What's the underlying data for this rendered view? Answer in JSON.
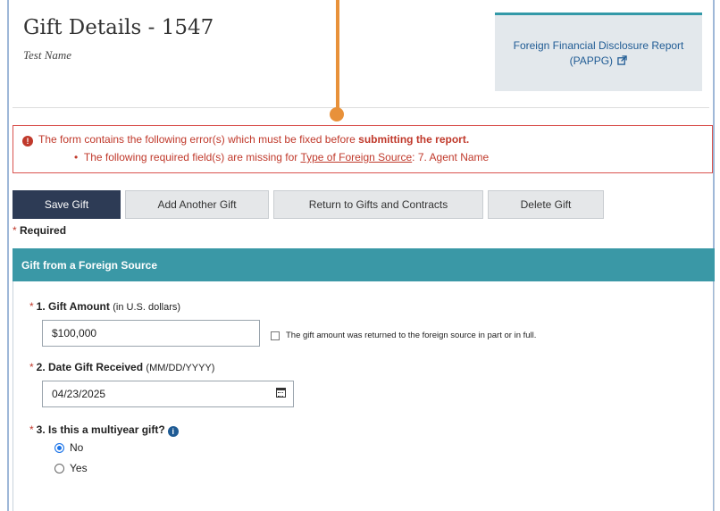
{
  "header": {
    "title": "Gift Details - 1547",
    "subtitle": "Test Name",
    "report_link": "Foreign Financial Disclosure Report (PAPPG)"
  },
  "error": {
    "line1_prefix": "The form contains the following error(s) which must be fixed before ",
    "line1_bold": "submitting the report.",
    "line2_prefix": "The following required field(s) are missing for ",
    "line2_link": "Type of Foreign Source",
    "line2_suffix": ": 7. Agent Name"
  },
  "buttons": {
    "save": "Save Gift",
    "add": "Add Another Gift",
    "return": "Return to Gifts and Contracts",
    "delete": "Delete Gift"
  },
  "required_note": "Required",
  "section": {
    "title": "Gift from a Foreign Source"
  },
  "q1": {
    "label": "1. Gift Amount",
    "hint": "(in U.S. dollars)",
    "value": "$100,000",
    "checkbox_label": "The gift amount was returned to the foreign source in part or in full."
  },
  "q2": {
    "label": "2. Date Gift Received",
    "hint": "(MM/DD/YYYY)",
    "value": "04/23/2025"
  },
  "q3": {
    "label": "3. Is this a multiyear gift?",
    "options": [
      "No",
      "Yes"
    ],
    "selected": "No"
  },
  "colors": {
    "primary_button": "#2d3b55",
    "section_header": "#3a98a6",
    "error": "#c0392b",
    "annotation": "#e8913a"
  },
  "icons": {
    "external_link": "external-link-icon",
    "error": "exclamation-circle-icon",
    "calendar": "calendar-icon",
    "info": "info-icon"
  }
}
